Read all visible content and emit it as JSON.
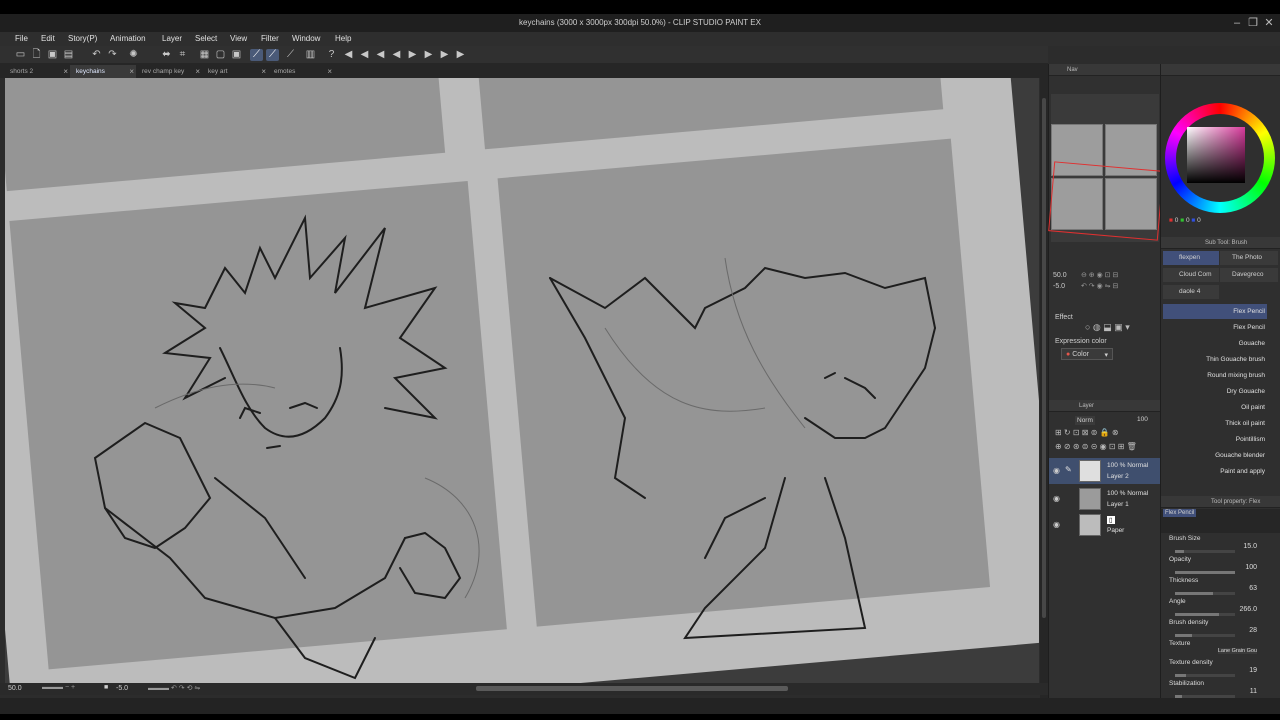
{
  "window": {
    "title": "keychains (3000 x 3000px 300dpi 50.0%) - CLIP STUDIO PAINT EX"
  },
  "menu": [
    "File",
    "Edit",
    "Story(P)",
    "Animation",
    "Layer",
    "Select",
    "View",
    "Filter",
    "Window",
    "Help"
  ],
  "tabs": [
    {
      "label": "shorts 2",
      "active": false
    },
    {
      "label": "keychains",
      "active": true
    },
    {
      "label": "rev champ key",
      "active": false
    },
    {
      "label": "key art",
      "active": false
    },
    {
      "label": "emotes",
      "active": false
    }
  ],
  "status": {
    "zoom": "50.0",
    "rotation": "-5.0"
  },
  "navigator": {
    "tab_label": "Nav",
    "zoom": "50.0",
    "rotation": "-5.0"
  },
  "effect": {
    "title": "Effect",
    "expression_color_label": "Expression color",
    "expression_color_value": "Color"
  },
  "layers": {
    "title": "Layer",
    "blend_mode": "Norm",
    "opacity": "100",
    "items": [
      {
        "mode": "100 % Normal",
        "name": "Layer 2",
        "selected": true
      },
      {
        "mode": "100 % Normal",
        "name": "Layer 1",
        "selected": false
      },
      {
        "mode": "",
        "name": "Paper",
        "selected": false
      }
    ]
  },
  "color": {
    "r": "0",
    "g": "0",
    "b": "0",
    "hue_color": "#d83a9c"
  },
  "subtool": {
    "title": "Sub Tool: Brush",
    "groups": [
      {
        "label": "flexpen",
        "active": true
      },
      {
        "label": "The Photo",
        "active": false
      },
      {
        "label": "Cloud Com",
        "active": false
      },
      {
        "label": "Davegreco",
        "active": false
      },
      {
        "label": "daole 4",
        "active": false
      }
    ],
    "brushes": [
      "Flex Pencil",
      "Flex Pencil",
      "Gouache",
      "Thin Gouache brush",
      "Round mixing brush",
      "Dry Gouache",
      "Oil paint",
      "Thick oil paint",
      "Pointillism",
      "Gouache blender",
      "Paint and apply"
    ]
  },
  "toolprop": {
    "title": "Tool property: Flex",
    "brush_name": "Flex Pencil",
    "items": [
      {
        "label": "Brush Size",
        "value": "15.0",
        "level": 0.15
      },
      {
        "label": "Opacity",
        "value": "100",
        "level": 1.0
      },
      {
        "label": "Thickness",
        "value": "63",
        "level": 0.63
      },
      {
        "label": "Angle",
        "value": "266.0",
        "level": 0.74
      },
      {
        "label": "Brush density",
        "value": "28",
        "level": 0.28
      },
      {
        "label": "Texture",
        "value": "Lane Grain Gou"
      },
      {
        "label": "Texture density",
        "value": "19",
        "level": 0.19
      },
      {
        "label": "Stabilization",
        "value": "11",
        "level": 0.11
      }
    ]
  }
}
